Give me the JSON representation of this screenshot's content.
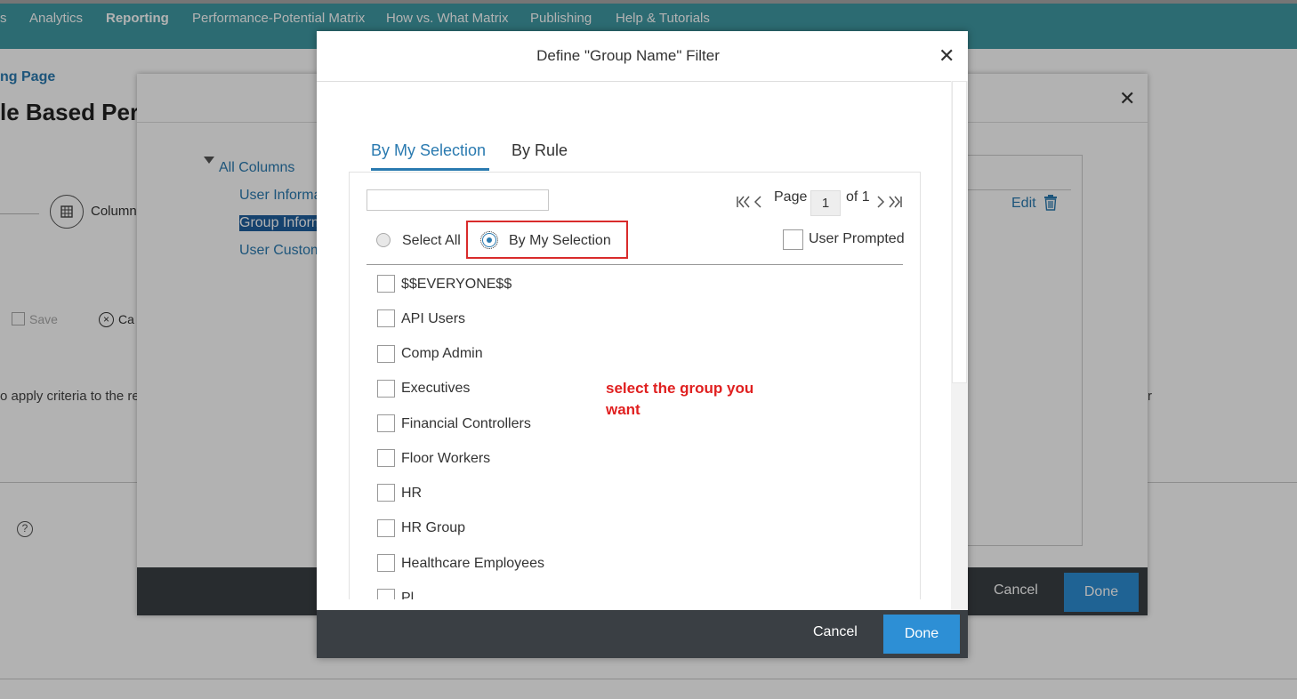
{
  "topnav": {
    "items": [
      {
        "label": "s"
      },
      {
        "label": "Analytics"
      },
      {
        "label": "Reporting"
      },
      {
        "label": "Performance-Potential Matrix"
      },
      {
        "label": "How vs. What Matrix"
      },
      {
        "label": "Publishing"
      },
      {
        "label": "Help & Tutorials"
      }
    ]
  },
  "background": {
    "breadcrumb": "ng Page",
    "page_title": "le Based Per",
    "columns_label": "Column",
    "save_label": "Save",
    "cancel_label": "Ca",
    "hint_text": "o apply criteria to the re",
    "right_text": "r"
  },
  "mid_dialog": {
    "tree_root": "All Columns",
    "tree_items": [
      "User Informa",
      "Group Inform",
      "User Custom"
    ],
    "edit_label": "Edit",
    "cancel_label": "Cancel",
    "done_label": "Done"
  },
  "dialog": {
    "title": "Define \"Group Name\" Filter",
    "tabs": [
      {
        "label": "By My Selection"
      },
      {
        "label": "By Rule"
      }
    ],
    "search": {
      "value": "",
      "placeholder": ""
    },
    "pager": {
      "page_label": "Page",
      "page_value": "1",
      "of_label": "of 1"
    },
    "select_all_label": "Select All",
    "by_my_selection_label": "By My Selection",
    "user_prompted_label": "User Prompted",
    "groups": [
      "$$EVERYONE$$",
      "API Users",
      "Comp Admin",
      "Executives",
      "Financial Controllers",
      "Floor Workers",
      "HR",
      "HR Group",
      "Healthcare Employees",
      "Pl"
    ],
    "cancel_label": "Cancel",
    "done_label": "Done"
  },
  "annotation": "select the group you want",
  "colors": {
    "nav": "#3f9aa4",
    "accent": "#2a7ab0",
    "footer": "#3a3f44",
    "done_button": "#2d8fd5",
    "annotation": "#e02020"
  }
}
